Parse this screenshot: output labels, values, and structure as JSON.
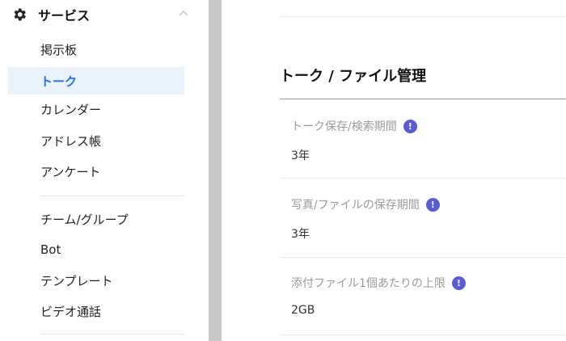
{
  "sidebar": {
    "section_title": "サービス",
    "items": [
      {
        "label": "掲示板",
        "active": false
      },
      {
        "label": "トーク",
        "active": true
      },
      {
        "label": "カレンダー",
        "active": false
      },
      {
        "label": "アドレス帳",
        "active": false
      },
      {
        "label": "アンケート",
        "active": false
      },
      {
        "label": "チーム/グループ",
        "active": false
      },
      {
        "label": "Bot",
        "active": false
      },
      {
        "label": "テンプレート",
        "active": false
      },
      {
        "label": "ビデオ通話",
        "active": false
      }
    ]
  },
  "main": {
    "title": "トーク / ファイル管理",
    "settings": [
      {
        "label": "トーク保存/検索期間",
        "value": "3年"
      },
      {
        "label": "写真/ファイルの保存期間",
        "value": "3年"
      },
      {
        "label": "添付ファイル1個あたりの上限",
        "value": "2GB"
      }
    ],
    "info_glyph": "!"
  },
  "colors": {
    "accent": "#1a73e8",
    "active_bg": "#eaf2fc",
    "info_icon": "#5b5bd6"
  }
}
